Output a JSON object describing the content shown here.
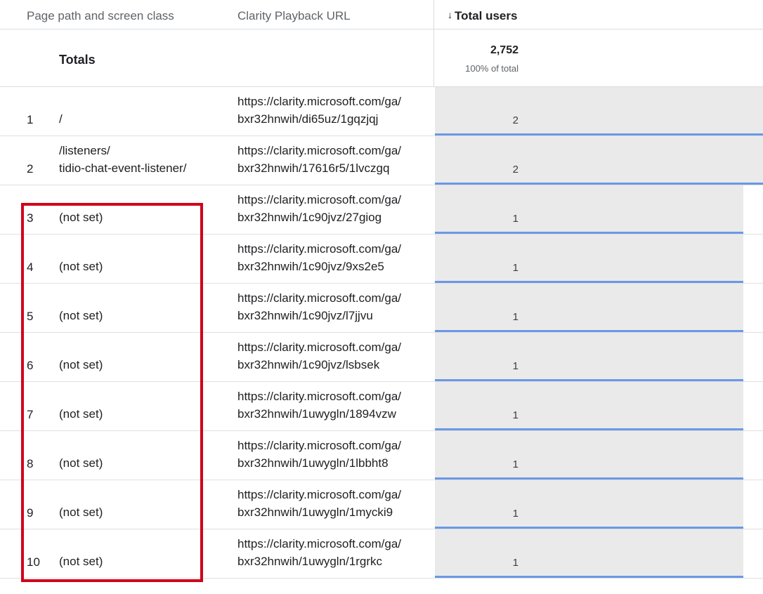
{
  "header": {
    "page_path_label": "Page path and screen class",
    "clarity_url_label": "Clarity Playback URL",
    "sort_arrow": "↓",
    "total_users_label": "Total users"
  },
  "totals": {
    "label": "Totals",
    "value": "2,752",
    "percent": "100% of total"
  },
  "rows": [
    {
      "rank": "1",
      "page": "/",
      "url_line1": "https://clarity.microsoft.com/ga/",
      "url_line2": "bxr32hnwih/di65uz/1gqzjqj",
      "users": "2",
      "bar_fraction": 1.0
    },
    {
      "rank": "2",
      "page_line1": "/listeners/",
      "page_line2": "tidio-chat-event-listener/",
      "url_line1": "https://clarity.microsoft.com/ga/",
      "url_line2": "bxr32hnwih/17616r5/1lvczgq",
      "users": "2",
      "bar_fraction": 1.0
    },
    {
      "rank": "3",
      "page": "(not set)",
      "url_line1": "https://clarity.microsoft.com/ga/",
      "url_line2": "bxr32hnwih/1c90jvz/27giog",
      "users": "1",
      "bar_fraction": 0.5
    },
    {
      "rank": "4",
      "page": "(not set)",
      "url_line1": "https://clarity.microsoft.com/ga/",
      "url_line2": "bxr32hnwih/1c90jvz/9xs2e5",
      "users": "1",
      "bar_fraction": 0.5
    },
    {
      "rank": "5",
      "page": "(not set)",
      "url_line1": "https://clarity.microsoft.com/ga/",
      "url_line2": "bxr32hnwih/1c90jvz/l7jjvu",
      "users": "1",
      "bar_fraction": 0.5
    },
    {
      "rank": "6",
      "page": "(not set)",
      "url_line1": "https://clarity.microsoft.com/ga/",
      "url_line2": "bxr32hnwih/1c90jvz/lsbsek",
      "users": "1",
      "bar_fraction": 0.5
    },
    {
      "rank": "7",
      "page": "(not set)",
      "url_line1": "https://clarity.microsoft.com/ga/",
      "url_line2": "bxr32hnwih/1uwygln/1894vzw",
      "users": "1",
      "bar_fraction": 0.5
    },
    {
      "rank": "8",
      "page": "(not set)",
      "url_line1": "https://clarity.microsoft.com/ga/",
      "url_line2": "bxr32hnwih/1uwygln/1lbbht8",
      "users": "1",
      "bar_fraction": 0.5
    },
    {
      "rank": "9",
      "page": "(not set)",
      "url_line1": "https://clarity.microsoft.com/ga/",
      "url_line2": "bxr32hnwih/1uwygln/1mycki9",
      "users": "1",
      "bar_fraction": 0.5
    },
    {
      "rank": "10",
      "page": "(not set)",
      "url_line1": "https://clarity.microsoft.com/ga/",
      "url_line2": "bxr32hnwih/1uwygln/1rgrkc",
      "users": "1",
      "bar_fraction": 0.5
    }
  ],
  "colors": {
    "bar_fill": "#eaeaea",
    "bar_underline": "#6a98e6",
    "highlight_box": "#d0021b"
  }
}
